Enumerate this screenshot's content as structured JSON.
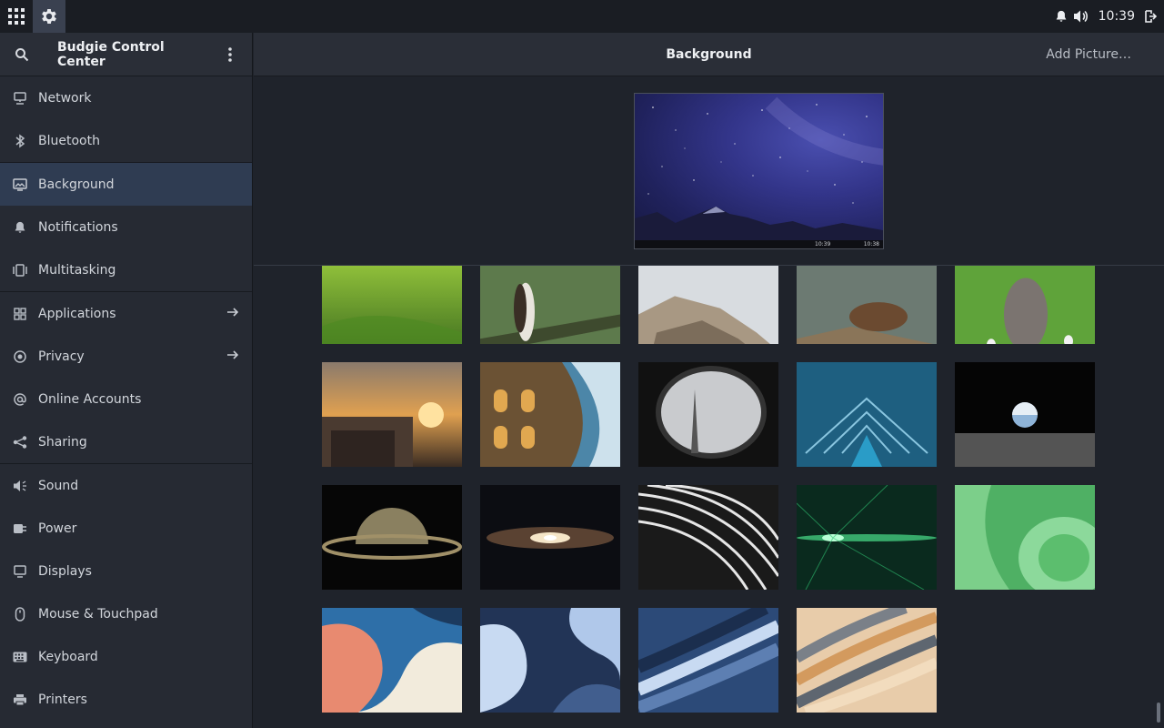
{
  "panel": {
    "clock": "10:39"
  },
  "sidebar": {
    "title": "Budgie Control Center",
    "items": [
      {
        "label": "Network"
      },
      {
        "label": "Bluetooth"
      },
      {
        "label": "Background"
      },
      {
        "label": "Notifications"
      },
      {
        "label": "Multitasking"
      },
      {
        "label": "Applications"
      },
      {
        "label": "Privacy"
      },
      {
        "label": "Online Accounts"
      },
      {
        "label": "Sharing"
      },
      {
        "label": "Sound"
      },
      {
        "label": "Power"
      },
      {
        "label": "Displays"
      },
      {
        "label": "Mouse & Touchpad"
      },
      {
        "label": "Keyboard"
      },
      {
        "label": "Printers"
      }
    ]
  },
  "main": {
    "title": "Background",
    "add_picture": "Add Picture…",
    "preview": {
      "left_time": "10:39",
      "right_time": "10:38"
    }
  },
  "colors": {
    "selected": "#2f3c52",
    "sidebar_bg": "#262a33",
    "main_bg": "#1f232b"
  }
}
